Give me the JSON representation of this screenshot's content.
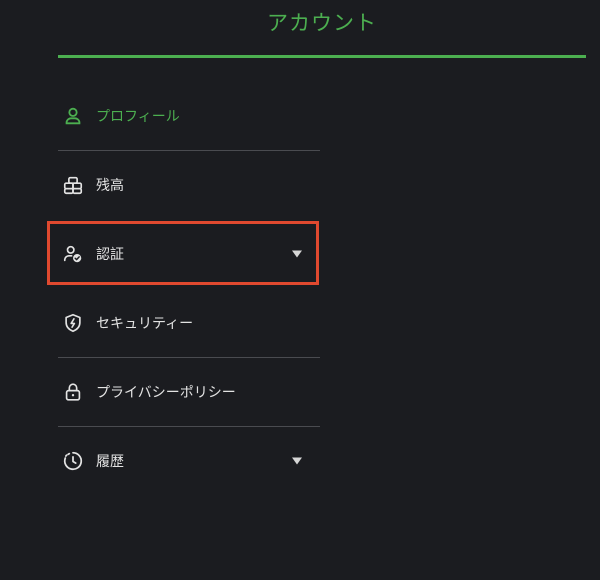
{
  "header": {
    "title": "アカウント",
    "accent_color": "#4caf50"
  },
  "menu": {
    "items": [
      {
        "label": "プロフィール",
        "icon": "user-icon",
        "active": true,
        "expandable": false
      },
      {
        "label": "残高",
        "icon": "coins-icon",
        "active": false,
        "expandable": false
      },
      {
        "label": "認証",
        "icon": "user-check-icon",
        "active": false,
        "expandable": true
      },
      {
        "label": "セキュリティー",
        "icon": "shield-icon",
        "active": false,
        "expandable": false
      },
      {
        "label": "プライバシーポリシー",
        "icon": "lock-icon",
        "active": false,
        "expandable": false
      },
      {
        "label": "履歴",
        "icon": "history-icon",
        "active": false,
        "expandable": true
      }
    ]
  },
  "highlight": {
    "target": "認証",
    "color": "#e0492f"
  }
}
